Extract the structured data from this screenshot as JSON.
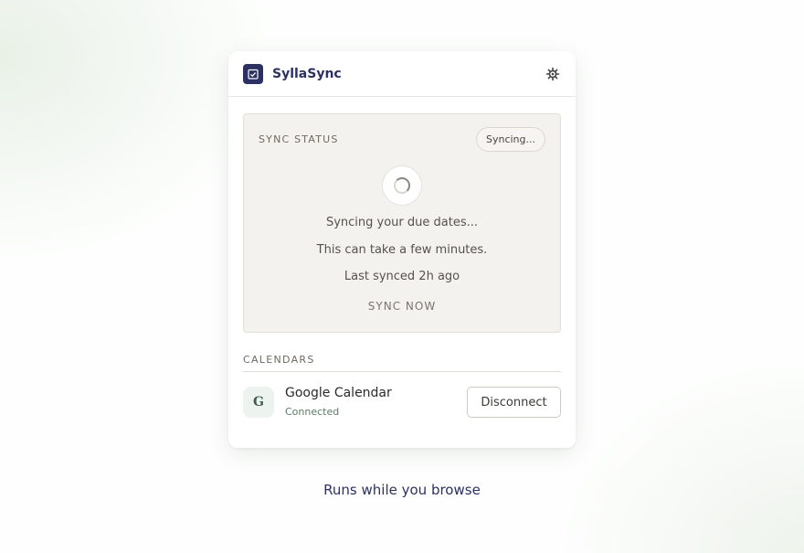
{
  "app": {
    "title": "SyllaSync",
    "logo_icon": "calendar-check-icon",
    "settings_icon": "gear-icon"
  },
  "sync": {
    "section_label": "SYNC STATUS",
    "badge": "Syncing...",
    "spinner_icon": "spinner-icon",
    "message_primary": "Syncing your due dates...",
    "message_secondary": "This can take a few minutes.",
    "last_synced": "Last synced 2h ago",
    "sync_now_label": "SYNC NOW"
  },
  "calendars": {
    "section_label": "CALENDARS",
    "items": [
      {
        "icon_letter": "G",
        "name": "Google Calendar",
        "status": "Connected",
        "action_label": "Disconnect"
      }
    ]
  },
  "tagline": "Runs while you browse",
  "colors": {
    "brand": "#2c3163",
    "panel_bg": "#f4f2ee",
    "connected": "#5c7c69"
  }
}
